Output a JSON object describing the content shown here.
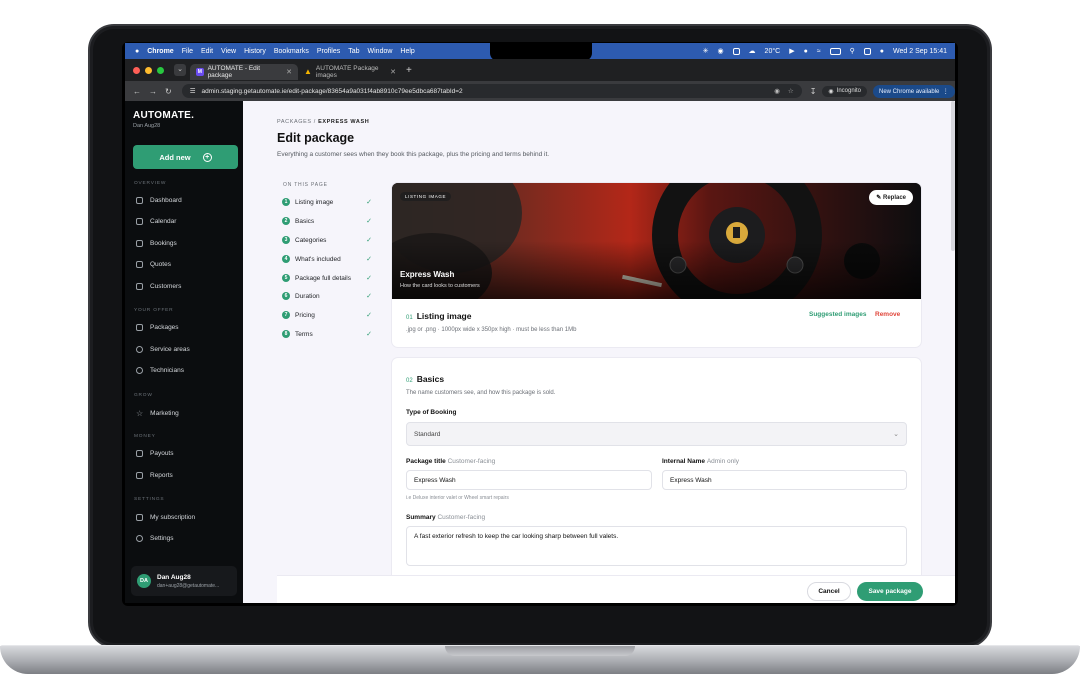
{
  "menubar": {
    "app": "Chrome",
    "items": [
      "File",
      "Edit",
      "View",
      "History",
      "Bookmarks",
      "Profiles",
      "Tab",
      "Window",
      "Help"
    ],
    "weather": "20°C",
    "datetime": "Wed 2 Sep  15:41"
  },
  "chrome": {
    "tabs": [
      {
        "title": "AUTOMATE - Edit package",
        "favicon": "M"
      },
      {
        "title": "AUTOMATE Package images"
      }
    ],
    "url": "admin.staging.getautomate.ie/edit-package/83654a9a031f4ab8910c79ee5dbca687tabId=2",
    "incognito": "Incognito",
    "update_label": "New Chrome available"
  },
  "sidebar": {
    "brand": "AUTOMATE.",
    "brand_sub": "Dan Aug28",
    "add_new": "Add new",
    "sections": {
      "overview": "OVERVIEW",
      "your_offer": "YOUR OFFER",
      "grow": "GROW",
      "money": "MONEY",
      "settings": "SETTINGS"
    },
    "items": {
      "dashboard": "Dashboard",
      "calendar": "Calendar",
      "bookings": "Bookings",
      "quotes": "Quotes",
      "customers": "Customers",
      "packages": "Packages",
      "service_areas": "Service areas",
      "technicians": "Technicians",
      "marketing": "Marketing",
      "payouts": "Payouts",
      "reports": "Reports",
      "my_subscription": "My subscription",
      "settings": "Settings"
    },
    "user": {
      "initials": "DA",
      "name": "Dan Aug28",
      "email": "dan+aug28@getautomate..."
    }
  },
  "page": {
    "breadcrumb_parent": "PACKAGES",
    "breadcrumb_sep": "/",
    "breadcrumb_current": "EXPRESS WASH",
    "title": "Edit package",
    "subtitle": "Everything a customer sees when they book this package, plus the pricing and terms behind it."
  },
  "toc": {
    "label": "ON THIS PAGE",
    "items": [
      {
        "num": "1",
        "label": "Listing image"
      },
      {
        "num": "2",
        "label": "Basics"
      },
      {
        "num": "3",
        "label": "Categories"
      },
      {
        "num": "4",
        "label": "What's included"
      },
      {
        "num": "5",
        "label": "Package full details"
      },
      {
        "num": "6",
        "label": "Duration"
      },
      {
        "num": "7",
        "label": "Pricing"
      },
      {
        "num": "8",
        "label": "Terms"
      }
    ]
  },
  "listing": {
    "badge": "LISTING IMAGE",
    "replace": "Replace",
    "card_title": "Express Wash",
    "card_sub": "How the card looks to customers",
    "section_num": "01",
    "section_title": "Listing image",
    "section_desc": ".jpg or .png · 1000px wide x 350px high · must be less than 1Mb",
    "suggested": "Suggested images",
    "remove": "Remove"
  },
  "basics": {
    "section_num": "02",
    "section_title": "Basics",
    "section_desc": "The name customers see, and how this package is sold.",
    "booking_type_label": "Type of Booking",
    "booking_type_value": "Standard",
    "package_title_label": "Package title",
    "package_title_hint_tag": "Customer-facing",
    "package_title_value": "Express Wash",
    "package_title_hint": "i.e Deluxe interior valet or Wheel smart repairs",
    "internal_name_label": "Internal Name",
    "internal_name_tag": "Admin only",
    "internal_name_value": "Express Wash",
    "summary_label": "Summary",
    "summary_tag": "Customer-facing",
    "summary_value": "A fast exterior refresh to keep the car looking sharp between full valets."
  },
  "footer": {
    "cancel": "Cancel",
    "save": "Save package"
  }
}
